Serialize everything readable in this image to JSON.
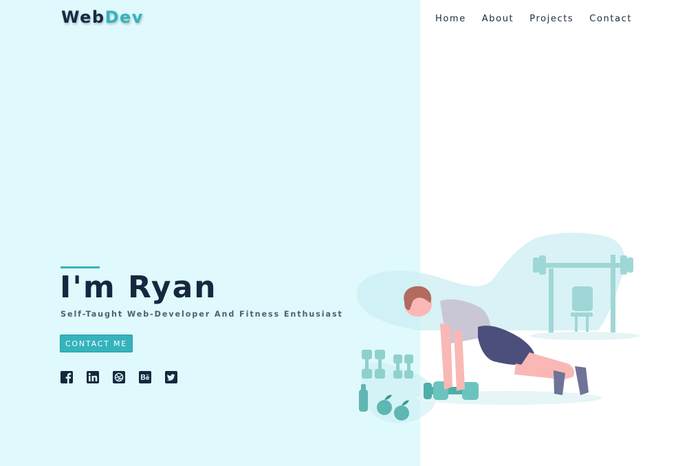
{
  "brand": {
    "part1": "Web",
    "part2": "Dev"
  },
  "nav": {
    "items": [
      {
        "label": "Home"
      },
      {
        "label": "About"
      },
      {
        "label": "Projects"
      },
      {
        "label": "Contact"
      }
    ]
  },
  "hero": {
    "title": "I'm Ryan",
    "subtitle": "Self-Taught Web-Developer And Fitness Enthusiast",
    "cta_label": "CONTACT ME"
  },
  "socials": [
    {
      "icon": "facebook-icon"
    },
    {
      "icon": "linkedin-icon"
    },
    {
      "icon": "dribbble-icon"
    },
    {
      "icon": "behance-icon"
    },
    {
      "icon": "twitter-icon"
    }
  ],
  "colors": {
    "left_panel_bg": "#dff9fd",
    "accent": "#35b3bc",
    "heading": "#16283f",
    "body_bg": "#ffffff"
  }
}
